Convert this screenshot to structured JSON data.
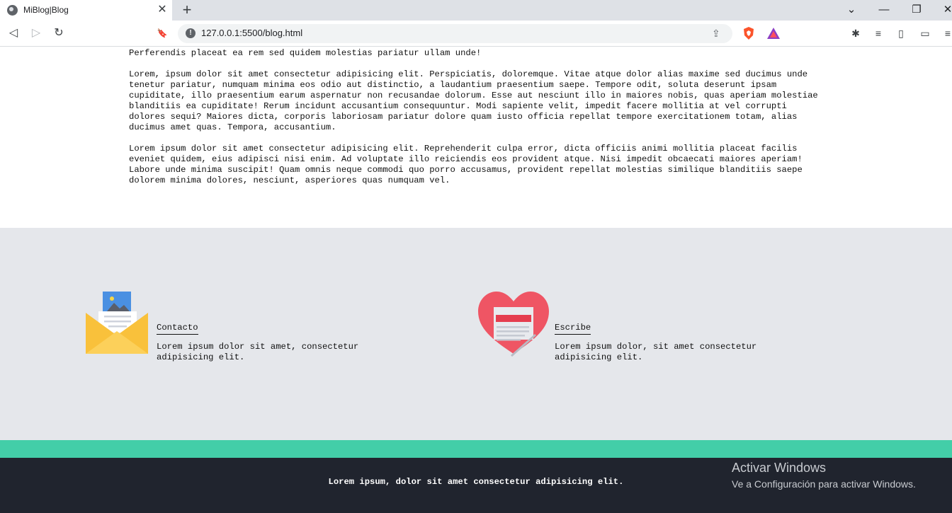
{
  "browser": {
    "tab_title": "MiBlog|Blog",
    "tab_close": "✕",
    "new_tab": "+",
    "url": "127.0.0.1:5500/blog.html",
    "window_controls": {
      "dropdown": "⌄",
      "minimize": "—",
      "restore": "❐",
      "close": "✕"
    },
    "nav": {
      "back": "◁",
      "forward": "▷",
      "reload": "↻",
      "bookmark": "🔖"
    },
    "extensions": {
      "puzzle": "✱",
      "playlist": "≡",
      "sidebar": "▯",
      "wallet": "▭",
      "menu": "≡"
    }
  },
  "article": {
    "paragraphs": [
      "Lorem ipsum dolor sit amet consectetur adipisicing elit. Praesentium cum eos suscipit aut ullam odio esse fugit aliquam ducimus ab! Perferendis placeat ea rem sed quidem molestias pariatur ullam unde!",
      "Lorem, ipsum dolor sit amet consectetur adipisicing elit. Perspiciatis, doloremque. Vitae atque dolor alias maxime sed ducimus unde tenetur pariatur, numquam minima eos odio aut distinctio, a laudantium praesentium saepe. Tempore odit, soluta deserunt ipsam cupiditate, illo praesentium earum aspernatur non recusandae dolorum. Esse aut nesciunt illo in maiores nobis, quas aperiam molestiae blanditiis ea cupiditate! Rerum incidunt accusantium consequuntur. Modi sapiente velit, impedit facere mollitia at vel corrupti dolores sequi? Maiores dicta, corporis laboriosam pariatur dolore quam iusto officia repellat tempore exercitationem totam, alias ducimus amet quas. Tempora, accusantium.",
      "Lorem ipsum dolor sit amet consectetur adipisicing elit. Reprehenderit culpa error, dicta officiis animi mollitia placeat facilis eveniet quidem, eius adipisci nisi enim. Ad voluptate illo reiciendis eos provident atque. Nisi impedit obcaecati maiores aperiam! Labore unde minima suscipit! Quam omnis neque commodi quo porro accusamus, provident repellat molestias similique blanditiis saepe dolorem minima dolores, nesciunt, asperiores quas numquam vel."
    ]
  },
  "features": {
    "contact": {
      "title": "Contacto",
      "description": "Lorem ipsum dolor sit amet, consectetur adipisicing elit."
    },
    "write": {
      "title": "Escribe",
      "description": "Lorem ipsum dolor, sit amet consectetur adipisicing elit."
    }
  },
  "footer": {
    "text": "Lorem ipsum, dolor sit amet consectetur adipisicing elit."
  },
  "watermark": {
    "title": "Activar Windows",
    "subtitle": "Ve a Configuración para activar Windows."
  },
  "colors": {
    "section_bg": "#e5e7eb",
    "accent": "#43cea8",
    "footer_bg": "#20242e"
  }
}
